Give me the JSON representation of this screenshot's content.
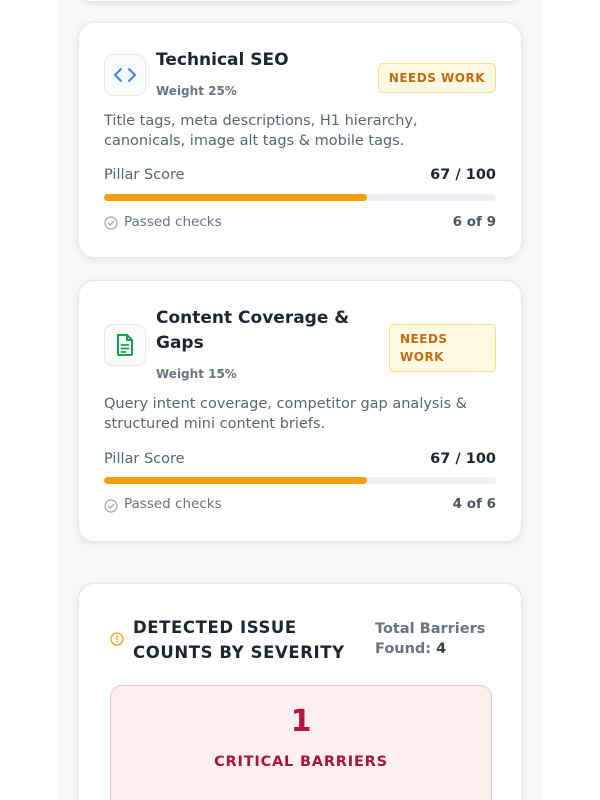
{
  "pillars": [
    {
      "title": "Technical SEO",
      "weight": "Weight 25%",
      "badge": "NEEDS WORK",
      "description": "Title tags, meta descriptions, H1 hierarchy, canonicals, image alt tags & mobile tags.",
      "score_label": "Pillar Score",
      "score": "67 / 100",
      "score_fraction": 0.67,
      "checks_label": "Passed checks",
      "checks": "6 of 9",
      "icon": "code-icon"
    },
    {
      "title": "Content Coverage & Gaps",
      "weight": "Weight 15%",
      "badge": "NEEDS WORK",
      "description": "Query intent coverage, competitor gap analysis & structured mini content briefs.",
      "score_label": "Pillar Score",
      "score": "67 / 100",
      "score_fraction": 0.67,
      "checks_label": "Passed checks",
      "checks": "4 of 6",
      "icon": "document-icon"
    }
  ],
  "severity": {
    "title": "DETECTED ISSUE COUNTS BY SEVERITY",
    "total_label": "Total Barriers Found:",
    "total_value": "4",
    "critical_count": "1",
    "critical_label": "CRITICAL BARRIERS"
  },
  "colors": {
    "accent_bar": "#f59e0b",
    "badge_text": "#c26a0e",
    "critical": "#b0163f",
    "doc_icon": "#16a34a",
    "code_icon": "#3b82f6"
  }
}
